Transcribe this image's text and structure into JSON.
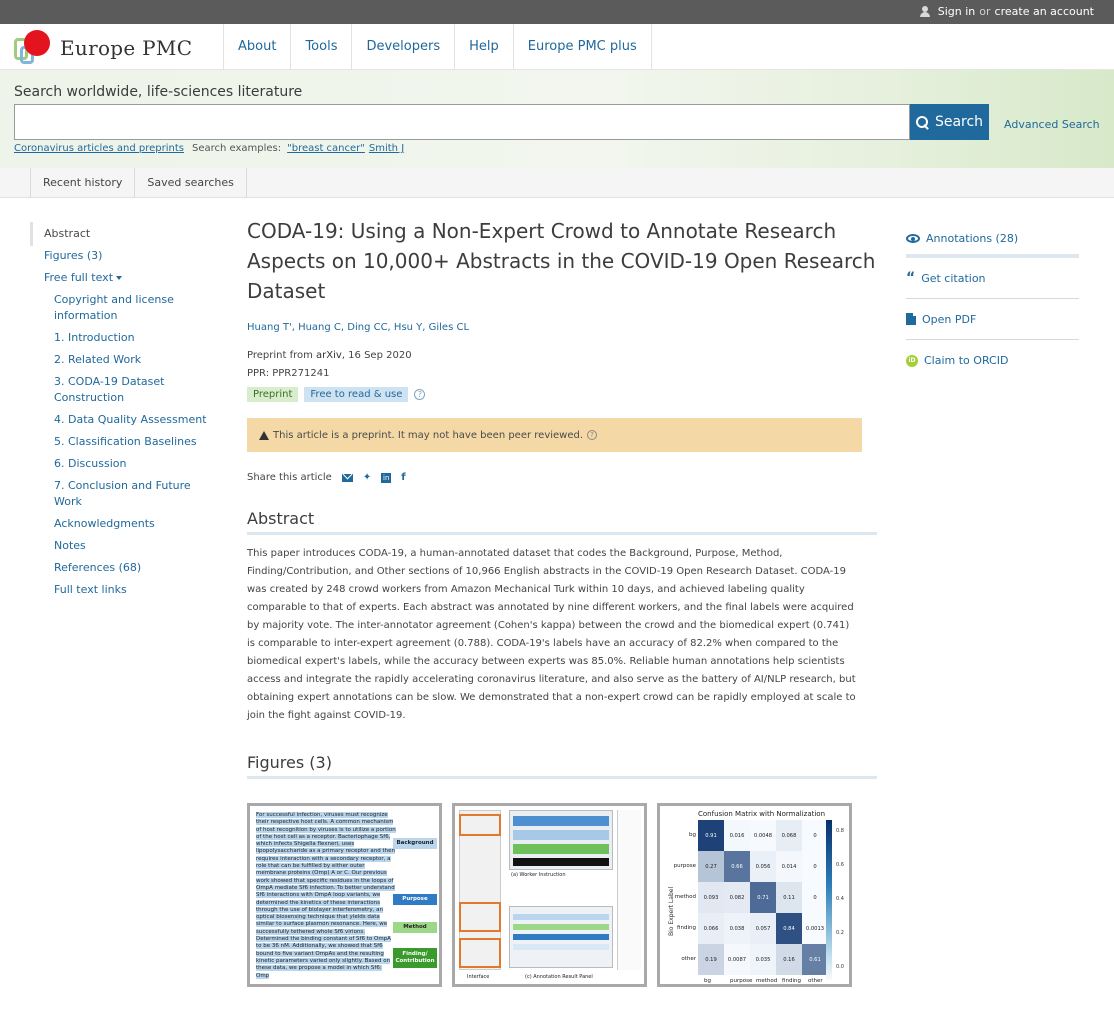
{
  "topbar": {
    "sign_in": "Sign in",
    "or": "or",
    "create_account": "create an account"
  },
  "brand": {
    "name": "Europe PMC"
  },
  "nav": [
    "About",
    "Tools",
    "Developers",
    "Help",
    "Europe PMC plus"
  ],
  "search": {
    "label": "Search worldwide, life-sciences literature",
    "placeholder": "",
    "button": "Search",
    "advanced": "Advanced Search",
    "covid_link": "Coronavirus articles and preprints",
    "examples_label": "Search examples:",
    "example1": "\"breast cancer\"",
    "example2": "Smith J"
  },
  "history": {
    "recent": "Recent history",
    "saved": "Saved searches"
  },
  "toc": {
    "abstract": "Abstract",
    "figures": "Figures (3)",
    "free_full_text": "Free full text",
    "items": [
      "Copyright and license information",
      "1. Introduction",
      "2. Related Work",
      "3. CODA-19 Dataset Construction",
      "4. Data Quality Assessment",
      "5. Classification Baselines",
      "6. Discussion",
      "7. Conclusion and Future Work",
      "Acknowledgments",
      "Notes",
      "References (68)",
      "Full text links"
    ]
  },
  "article": {
    "title": "CODA-19: Using a Non-Expert Crowd to Annotate Research Aspects on 10,000+ Abstracts in the COVID-19 Open Research Dataset",
    "authors": "Huang T', Huang C, Ding CC, Hsu Y, Giles CL",
    "preprint_prefix": "Preprint from ",
    "source": "arXiv",
    "date": ", 16 Sep 2020",
    "ppr": "PPR: PPR271241",
    "badge_preprint": "Preprint",
    "badge_free": "Free to read & use",
    "warning": "This article is a preprint. It may not have been peer reviewed.",
    "share_label": "Share this article",
    "abstract_heading": "Abstract",
    "abstract": "This paper introduces CODA-19, a human-annotated dataset that codes the Background, Purpose, Method, Finding/Contribution, and Other sections of 10,966 English abstracts in the COVID-19 Open Research Dataset. CODA-19 was created by 248 crowd workers from Amazon Mechanical Turk within 10 days, and achieved labeling quality comparable to that of experts. Each abstract was annotated by nine different workers, and the final labels were acquired by majority vote. The inter-annotator agreement (Cohen's kappa) between the crowd and the biomedical expert (0.741) is comparable to inter-expert agreement (0.788). CODA-19's labels have an accuracy of 82.2% when compared to the biomedical expert's labels, while the accuracy between experts was 85.0%. Reliable human annotations help scientists access and integrate the rapidly accelerating coronavirus literature, and also serve as the battery of AI/NLP research, but obtaining expert annotations can be slow. We demonstrated that a non-expert crowd can be rapidly employed at scale to join the fight against COVID-19.",
    "figures_heading": "Figures (3)"
  },
  "figure1": {
    "text": "For successful infection, viruses must recognize their respective host cells. A common mechanism of host recognition by viruses is to utilize a portion of the host cell as a receptor. Bacteriophage Sf6, which infects Shigella flexneri, uses lipopolysaccharide as a primary receptor and then requires interaction with a secondary receptor, a role that can be fulfilled by either outer membrane proteins (Omp) A or C. Our previous work showed that specific residues in the loops of OmpA mediate Sf6 infection. To better understand Sf6 interactions with OmpA loop variants, we determined the kinetics of these interactions through the use of biolayer interferometry, an optical biosensing technique that yields data similar to surface plasmon resonance. Here, we successfully tethered whole Sf6 virions. Determined the binding constant of Sf6 to OmpA to be 36 nM. Additionally, we showed that Sf6 bound to five variant OmpAs and the resulting kinetic parameters varied only slightly. Based on these data, we propose a model in which Sf6: Omp",
    "labels": [
      "Background",
      "Purpose",
      "Method",
      "Finding/ Contribution"
    ]
  },
  "figure2": {
    "caption_a": "(a) Worker Instruction",
    "caption_b": "Interface",
    "caption_c": "(c) Annotation Result Panel"
  },
  "figure3": {
    "title": "Confusion Matrix with Normalization",
    "ylabel": "Bio Expert Label",
    "rows": [
      "bg",
      "purpose",
      "method",
      "finding",
      "other"
    ],
    "cols": [
      "bg",
      "purpose",
      "method",
      "finding",
      "other"
    ],
    "values": [
      [
        "0.91",
        "0.016",
        "0.0048",
        "0.068",
        "0"
      ],
      [
        "0.27",
        "0.66",
        "0.056",
        "0.014",
        "0"
      ],
      [
        "0.093",
        "0.082",
        "0.71",
        "0.11",
        "0"
      ],
      [
        "0.066",
        "0.038",
        "0.057",
        "0.84",
        "0.0013"
      ],
      [
        "0.19",
        "0.0087",
        "0.035",
        "0.16",
        "0.61"
      ]
    ],
    "colorbar_ticks": [
      "0.8",
      "0.6",
      "0.4",
      "0.2",
      "0.0"
    ]
  },
  "sidebar": {
    "annotations": "Annotations (28)",
    "citation": "Get citation",
    "pdf": "Open PDF",
    "orcid": "Claim to ORCID"
  },
  "colors": {
    "accent": "#20699c",
    "warning_bg": "#f4d9a6",
    "topbar": "#5b5b5b"
  }
}
